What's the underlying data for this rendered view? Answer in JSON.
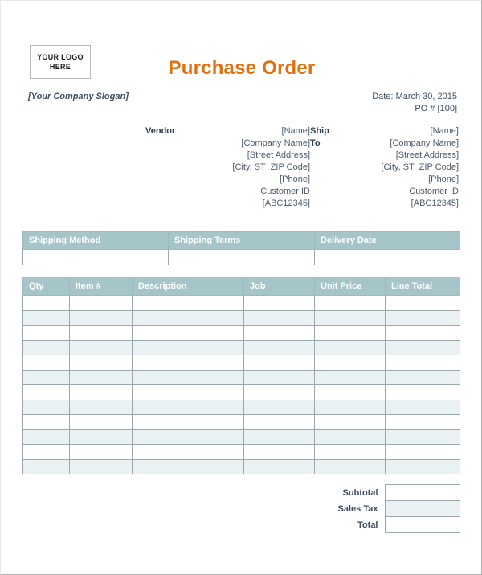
{
  "document": {
    "title": "Purchase Order",
    "title_color": "#E2700E",
    "slogan": "[Your Company Slogan]",
    "logo": {
      "line1": "YOUR LOGO",
      "line2": "HERE"
    },
    "meta": {
      "date": "Date: March 30, 2015",
      "po_number": "PO # [100]"
    }
  },
  "addresses": {
    "vendor": {
      "label": "Vendor",
      "lines": [
        "[Name]",
        "[Company Name]",
        "[Street Address]",
        "[City, ST  ZIP Code]",
        "[Phone]",
        "Customer ID",
        "[ABC12345]"
      ]
    },
    "ship_to": {
      "label_line1": "Ship",
      "label_line2": "To",
      "lines": [
        "[Name]",
        "[Company Name]",
        "[Street Address]",
        "[City, ST  ZIP Code]",
        "[Phone]",
        "Customer ID",
        "[ABC12345]"
      ]
    }
  },
  "shipping_table": {
    "headers": [
      "Shipping Method",
      "Shipping Terms",
      "Delivery Date"
    ],
    "rows": [
      [
        "",
        "",
        ""
      ]
    ]
  },
  "items_table": {
    "headers": [
      "Qty",
      "Item #",
      "Description",
      "Job",
      "Unit Price",
      "Line Total"
    ],
    "row_count": 12,
    "rows": [
      [
        "",
        "",
        "",
        "",
        "",
        ""
      ],
      [
        "",
        "",
        "",
        "",
        "",
        ""
      ],
      [
        "",
        "",
        "",
        "",
        "",
        ""
      ],
      [
        "",
        "",
        "",
        "",
        "",
        ""
      ],
      [
        "",
        "",
        "",
        "",
        "",
        ""
      ],
      [
        "",
        "",
        "",
        "",
        "",
        ""
      ],
      [
        "",
        "",
        "",
        "",
        "",
        ""
      ],
      [
        "",
        "",
        "",
        "",
        "",
        ""
      ],
      [
        "",
        "",
        "",
        "",
        "",
        ""
      ],
      [
        "",
        "",
        "",
        "",
        "",
        ""
      ],
      [
        "",
        "",
        "",
        "",
        "",
        ""
      ],
      [
        "",
        "",
        "",
        "",
        "",
        ""
      ]
    ]
  },
  "totals": {
    "rows": [
      {
        "label": "Subtotal",
        "value": "",
        "shaded": false
      },
      {
        "label": "Sales Tax",
        "value": "",
        "shaded": true
      },
      {
        "label": "Total",
        "value": "",
        "shaded": false
      }
    ]
  },
  "theme": {
    "header_fill": "#a5c5c8",
    "stripe_fill": "#eaf1f2",
    "text_color": "#3d4f63",
    "border_color": "#9aa7ac"
  }
}
